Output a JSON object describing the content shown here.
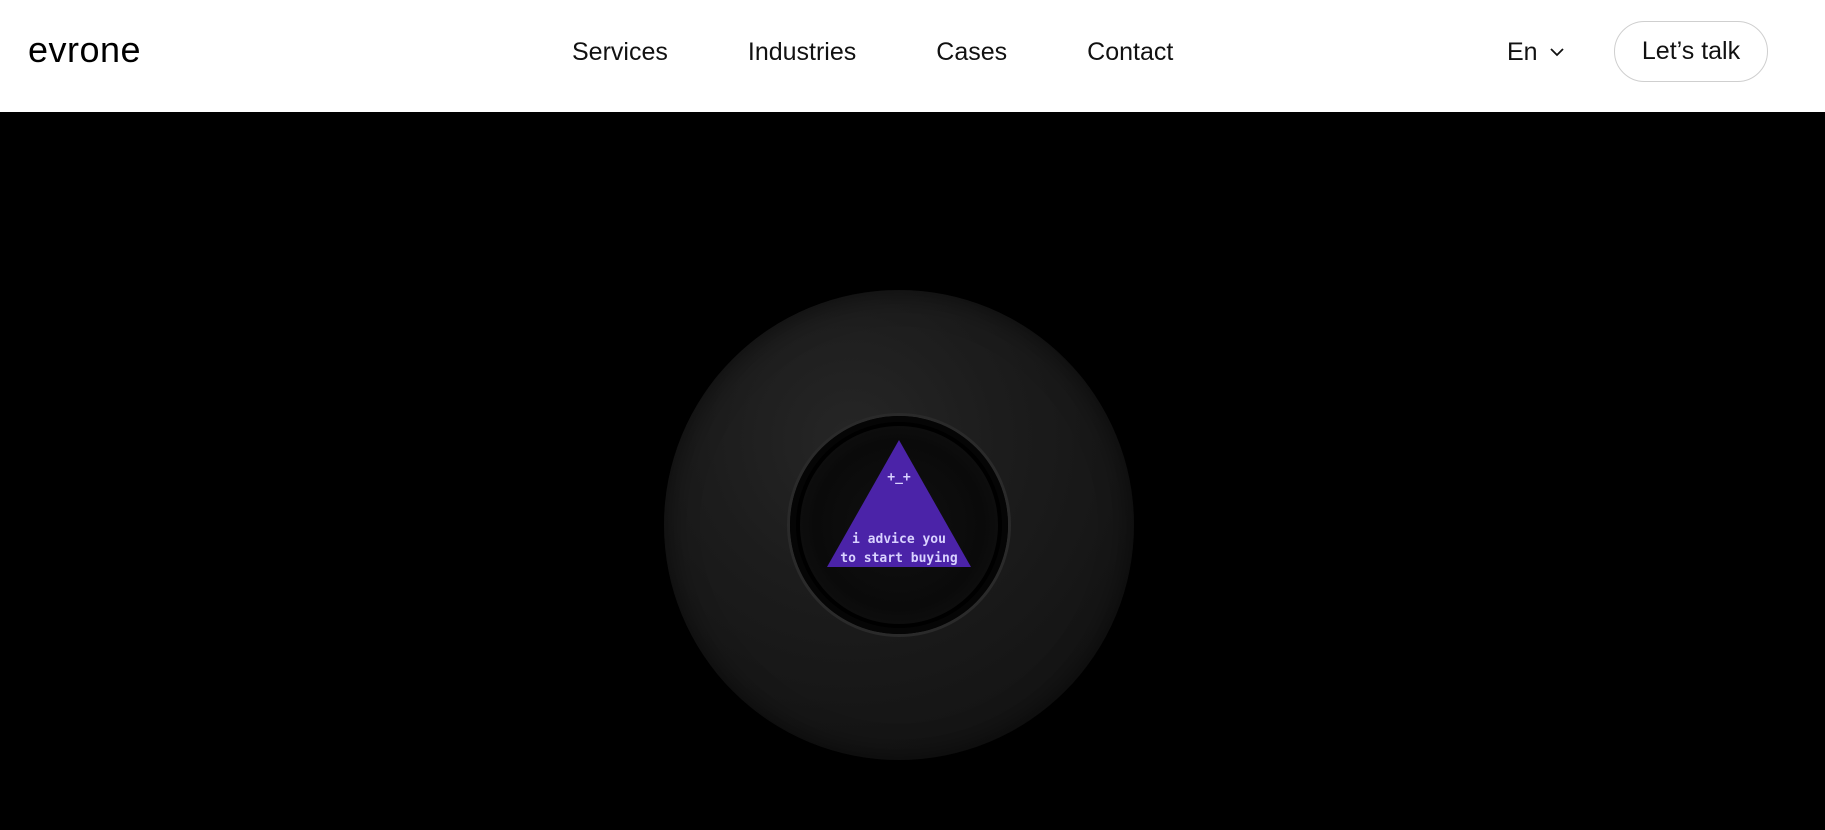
{
  "header": {
    "logo": "evrone",
    "nav": [
      "Services",
      "Industries",
      "Cases",
      "Contact"
    ],
    "language": "En",
    "cta": "Let’s talk"
  },
  "hero": {
    "ball": {
      "face": "+_+",
      "message_line1": "i advice you",
      "message_line2": "to start buying",
      "triangle_color": "#4b23a8"
    }
  },
  "colors": {
    "background": "#000000",
    "header_bg": "#ffffff",
    "accent": "#4b23a8"
  }
}
